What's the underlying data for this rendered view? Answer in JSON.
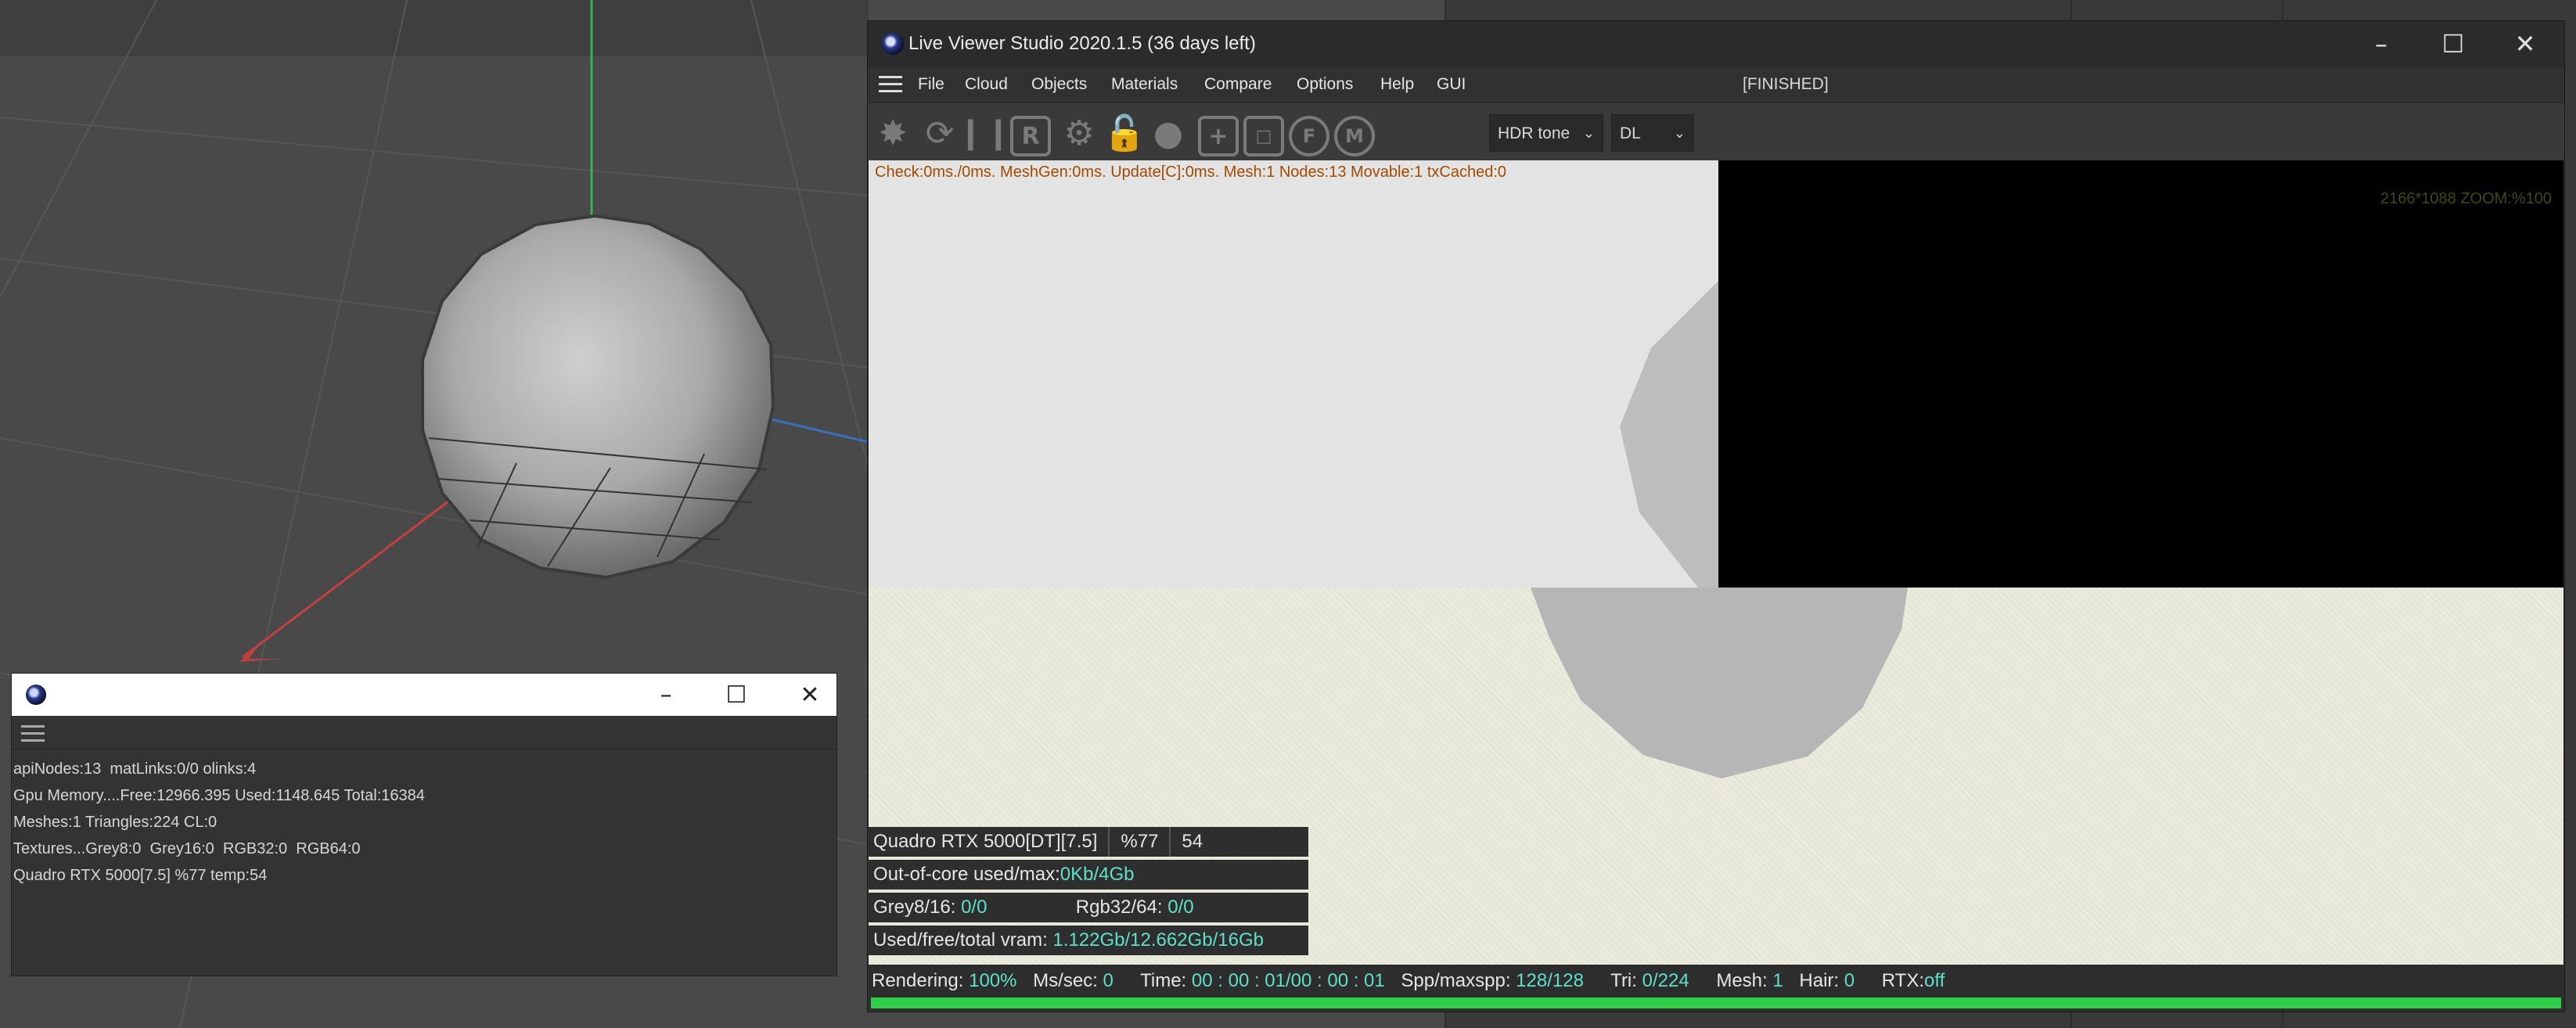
{
  "small_window": {
    "info_lines": [
      "apiNodes:13  matLinks:0/0 olinks:4",
      "Gpu Memory....Free:12966.395 Used:1148.645 Total:16384",
      "Meshes:1 Triangles:224 CL:0",
      "Textures...Grey8:0  Grey16:0  RGB32:0  RGB64:0",
      "Quadro RTX 5000[7.5] %77 temp:54"
    ]
  },
  "main_window": {
    "title": "Live Viewer Studio 2020.1.5 (36 days left)",
    "menu": [
      "File",
      "Cloud",
      "Objects",
      "Materials",
      "Compare",
      "Options",
      "Help",
      "GUI"
    ],
    "status": "[FINISHED]",
    "toolbar": {
      "tonemap_select": "HDR tone",
      "kernel_select": "DL",
      "icons": [
        "restart-render-icon",
        "refresh-icon",
        "pause-icon",
        "region-render-icon",
        "settings-gear-icon",
        "lock-icon",
        "material-ball-icon",
        "add-icon",
        "focus-picker-icon",
        "film-picker-icon",
        "material-picker-icon"
      ],
      "icon_glyphs": {
        "region": "R",
        "film": "F",
        "material": "M"
      }
    },
    "render": {
      "stats_line": "Check:0ms./0ms. MeshGen:0ms. Update[C]:0ms. Mesh:1 Nodes:13 Movable:1 txCached:0",
      "resolution_label": "2166*1088 ZOOM:%100"
    },
    "overlay": {
      "gpu_name": "Quadro RTX 5000[DT][7.5]",
      "gpu_percent": "%77",
      "gpu_temp": "54",
      "ooc_label": "Out-of-core used/max:",
      "ooc_value": "0Kb/4Gb",
      "grey_label": "Grey8/16:",
      "grey_value": "0/0",
      "rgb_label": "Rgb32/64:",
      "rgb_value": "0/0",
      "vram_label": "Used/free/total vram:",
      "vram_value": "1.122Gb/12.662Gb/16Gb"
    },
    "statusbar": {
      "rendering_label": "Rendering:",
      "rendering_value": "100%",
      "ms_label": "Ms/sec:",
      "ms_value": "0",
      "time_label": "Time:",
      "time_value": "00 : 00 : 01/00 : 00 : 01",
      "spp_label": "Spp/maxspp:",
      "spp_value": "128/128",
      "tri_label": "Tri:",
      "tri_value": "0/224",
      "mesh_label": "Mesh:",
      "mesh_value": "1",
      "hair_label": "Hair:",
      "hair_value": "0",
      "rtx_label": "RTX:",
      "rtx_value": "off",
      "progress": 1.0
    }
  },
  "colors": {
    "accent_value": "#5fe0c8",
    "progress": "#2fcf4a",
    "stats_text": "#a34a00"
  }
}
